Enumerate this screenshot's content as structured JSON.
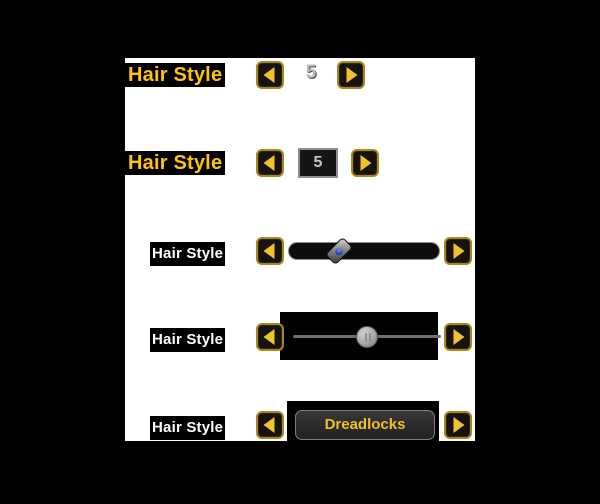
{
  "screen": {
    "background_color": "#000000",
    "panel_color": "#ffffff"
  },
  "rows": [
    {
      "id": "row-plain-value",
      "label": "Hair Style",
      "label_color": "#ffc20e",
      "prev_icon": "triangle-left-icon",
      "next_icon": "triangle-right-icon",
      "value": "5",
      "control": "stepper-plain"
    },
    {
      "id": "row-boxed-value",
      "label": "Hair Style",
      "label_color": "#ffc20e",
      "prev_icon": "triangle-left-icon",
      "next_icon": "triangle-right-icon",
      "value": "5",
      "control": "stepper-boxed"
    },
    {
      "id": "row-pill-slider",
      "label": "Hair Style",
      "label_color": "#ffffff",
      "prev_icon": "triangle-left-icon",
      "next_icon": "triangle-right-icon",
      "control": "slider-pill",
      "slider_percent": 33
    },
    {
      "id": "row-line-slider",
      "label": "Hair Style",
      "label_color": "#ffffff",
      "prev_icon": "triangle-left-icon",
      "next_icon": "triangle-right-icon",
      "control": "slider-line",
      "slider_percent": 50
    },
    {
      "id": "row-option-button",
      "label": "Hair Style",
      "label_color": "#ffffff",
      "prev_icon": "triangle-left-icon",
      "next_icon": "triangle-right-icon",
      "control": "option-button",
      "option_value": "Dreadlocks",
      "option_text_color": "#f0bf29"
    }
  ],
  "theme": {
    "gold_border": "#a8871c",
    "gold_arrow": "#f0c32c",
    "dark_fill": "#151210",
    "knob_gem": "#1433b5"
  }
}
